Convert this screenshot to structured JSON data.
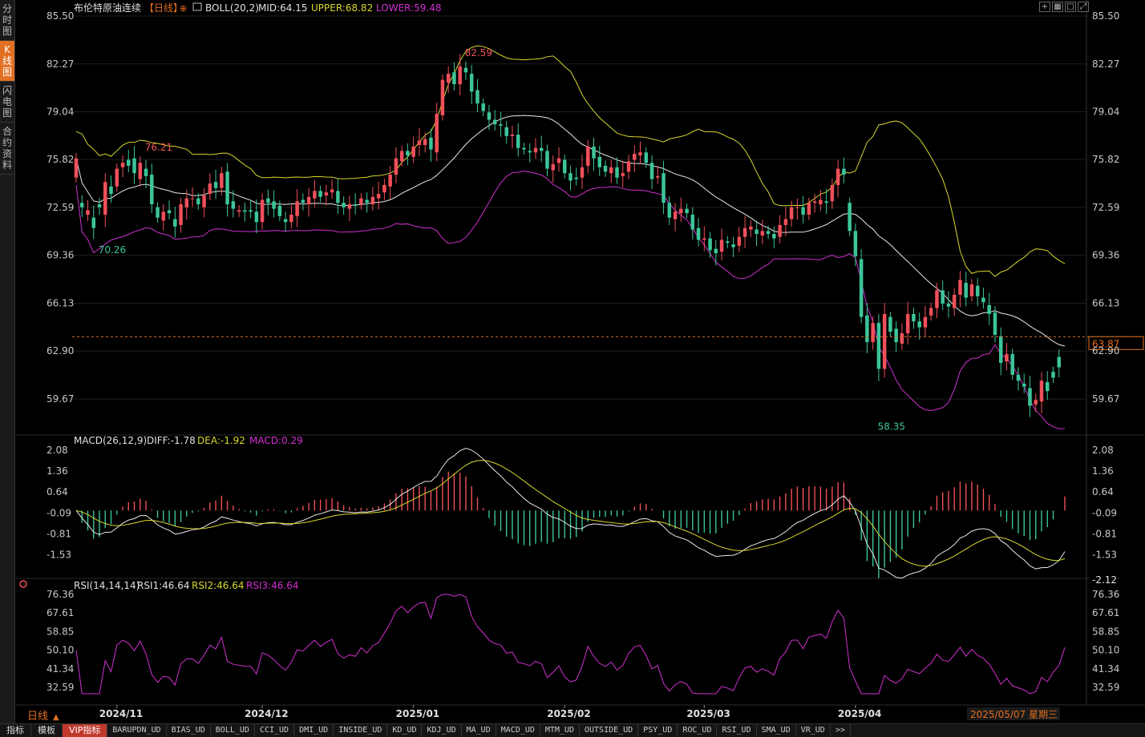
{
  "sidebar": {
    "tabs": [
      {
        "label": "分时图",
        "active": false
      },
      {
        "label": "K线图",
        "active": true
      },
      {
        "label": "闪电图",
        "active": false
      },
      {
        "label": "合约资料",
        "active": false
      }
    ]
  },
  "header": {
    "title": "布伦特原油连续",
    "period": "【日线】",
    "indicator": "BOLL(20,2)",
    "mid": "MID:64.15",
    "upper": "UPPER:68.82",
    "lower": "LOWER:59.48"
  },
  "macd_header": {
    "name": "MACD(26,12,9)",
    "diff": "DIFF:-1.78",
    "dea": "DEA:-1.92",
    "macd": "MACD:0.29"
  },
  "rsi_header": {
    "name": "RSI(14,14,14)",
    "rsi1": "RSI1:46.64",
    "rsi2": "RSI2:46.64",
    "rsi3": "RSI3:46.64"
  },
  "footer": {
    "period_label": "日线",
    "date_label": "2025/05/07 星期三"
  },
  "bottom_tabs": [
    "指标",
    "模板",
    "VIP指标"
  ],
  "indicator_tabs": [
    "BARUPDN_UD",
    "BIAS_UD",
    "BOLL_UD",
    "CCI_UD",
    "DMI_UD",
    "INSIDE_UD",
    "KD_UD",
    "KDJ_UD",
    "MA_UD",
    "MACD_UD",
    "MTM_UD",
    "OUTSIDE_UD",
    "PSY_UD",
    "ROC_UD",
    "RSI_UD",
    "SMA_UD",
    "VR_UD",
    ">>"
  ],
  "colors": {
    "up": "#f0505a",
    "down": "#3cc59a",
    "mid": "#e8e8e8",
    "upper": "#d8d830",
    "lower": "#d030d0",
    "accent": "#e26f22"
  },
  "chart_data": {
    "type": "candlestick",
    "price_axis": {
      "ticks": [
        "85.50",
        "82.27",
        "79.04",
        "75.82",
        "72.59",
        "69.36",
        "66.13",
        "62.90",
        "59.67"
      ],
      "ylim": [
        57.4,
        85.5
      ]
    },
    "last_price": "63.87",
    "annotations": [
      {
        "text": "76.21",
        "kind": "high"
      },
      {
        "text": "70.26",
        "kind": "low"
      },
      {
        "text": "82.59",
        "kind": "high"
      },
      {
        "text": "58.35",
        "kind": "low"
      }
    ],
    "month_labels": [
      "2024/11",
      "2024/12",
      "2025/01",
      "2025/02",
      "2025/03",
      "2025/04"
    ],
    "month_candle_index": [
      7,
      32,
      58,
      84,
      108,
      134
    ],
    "candles_close": [
      75.9,
      72.6,
      72.4,
      71.2,
      72.6,
      74.3,
      73.5,
      75.2,
      75.6,
      75.4,
      74.9,
      75.6,
      74.7,
      72.8,
      71.9,
      72.3,
      72.2,
      71.3,
      72.8,
      73.2,
      73.2,
      72.8,
      73.4,
      74.2,
      73.9,
      74.9,
      72.8,
      72.5,
      72.4,
      72.3,
      72.3,
      71.6,
      73.1,
      72.9,
      72.5,
      72.0,
      71.6,
      72.1,
      73.0,
      72.9,
      73.3,
      73.7,
      73.3,
      73.6,
      73.8,
      72.9,
      72.6,
      72.8,
      72.7,
      73.2,
      72.9,
      73.3,
      73.5,
      74.1,
      74.8,
      75.9,
      76.4,
      76.1,
      76.7,
      77.1,
      77.2,
      76.5,
      78.9,
      81.2,
      81.6,
      80.9,
      82.1,
      81.7,
      80.4,
      79.6,
      79.1,
      78.5,
      78.2,
      78.1,
      77.4,
      77.5,
      76.6,
      76.5,
      76.3,
      76.6,
      76.4,
      75.2,
      75.5,
      75.9,
      74.9,
      74.4,
      74.5,
      75.3,
      76.7,
      75.9,
      75.3,
      75.0,
      75.3,
      74.6,
      74.9,
      75.7,
      76.2,
      76.3,
      75.6,
      74.5,
      74.7,
      72.9,
      71.9,
      72.3,
      72.5,
      72.2,
      71.1,
      70.4,
      70.5,
      69.7,
      69.5,
      70.4,
      70.2,
      69.9,
      70.6,
      71.2,
      71.3,
      70.8,
      71.0,
      70.8,
      70.5,
      71.4,
      71.8,
      72.6,
      72.6,
      72.1,
      72.9,
      73.0,
      73.1,
      72.9,
      74.1,
      75.2,
      74.8,
      71.0,
      69.3,
      65.2,
      63.5,
      64.8,
      61.7,
      65.4,
      64.2,
      63.5,
      64.1,
      65.4,
      64.9,
      64.5,
      65.2,
      65.8,
      67.0,
      66.1,
      65.9,
      66.7,
      67.7,
      66.5,
      67.4,
      66.6,
      66.2,
      65.4,
      64.0,
      62.1,
      62.7,
      61.3,
      60.9,
      60.5,
      59.2,
      59.6,
      60.9,
      60.2,
      61.1,
      61.8,
      63.9
    ],
    "candles_open": [
      74.6,
      72.9,
      72.1,
      71.9,
      72.8,
      72.1,
      74.0,
      74.0,
      75.3,
      75.8,
      75.9,
      74.5,
      75.2,
      74.8,
      72.6,
      71.7,
      72.4,
      71.8,
      71.4,
      72.6,
      73.2,
      73.2,
      72.6,
      73.5,
      74.3,
      73.9,
      75.0,
      73.0,
      72.3,
      72.4,
      72.4,
      72.3,
      71.6,
      73.2,
      73.0,
      72.7,
      71.8,
      71.6,
      72.0,
      73.1,
      72.8,
      73.2,
      73.7,
      73.4,
      73.6,
      73.7,
      72.9,
      72.5,
      72.8,
      72.8,
      73.1,
      72.8,
      73.2,
      73.6,
      74.0,
      74.8,
      75.7,
      76.4,
      76.0,
      76.8,
      76.8,
      77.3,
      76.3,
      78.8,
      81.0,
      81.7,
      80.9,
      82.0,
      81.6,
      80.5,
      79.6,
      79.0,
      78.5,
      78.2,
      78.0,
      77.4,
      77.5,
      76.6,
      76.4,
      76.3,
      76.6,
      76.4,
      75.1,
      75.6,
      75.8,
      74.9,
      74.6,
      74.6,
      75.4,
      76.7,
      76.0,
      75.4,
      74.9,
      75.3,
      74.7,
      75.0,
      75.8,
      76.1,
      76.3,
      75.6,
      74.6,
      74.9,
      72.9,
      71.8,
      72.2,
      72.5,
      72.1,
      71.2,
      70.4,
      70.5,
      69.8,
      69.6,
      70.3,
      70.1,
      70.0,
      70.6,
      71.1,
      71.1,
      70.7,
      71.0,
      70.8,
      70.6,
      71.4,
      71.8,
      72.6,
      72.6,
      72.1,
      72.9,
      72.8,
      73.0,
      73.0,
      74.1,
      75.2,
      72.9,
      71.0,
      69.1,
      65.3,
      63.5,
      64.8,
      61.7,
      65.2,
      64.4,
      63.4,
      64.1,
      65.4,
      64.9,
      64.5,
      65.3,
      65.8,
      67.0,
      66.1,
      65.8,
      66.7,
      67.5,
      66.6,
      67.3,
      66.5,
      66.0,
      65.5,
      63.9,
      62.2,
      62.7,
      61.3,
      60.7,
      60.4,
      59.3,
      59.5,
      60.8,
      61.5,
      62.5
    ]
  }
}
